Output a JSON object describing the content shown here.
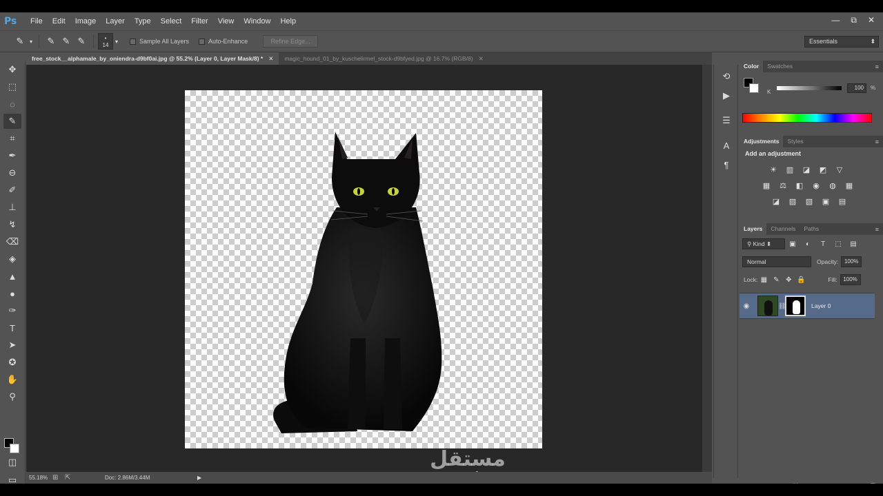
{
  "app": {
    "logo": "Ps"
  },
  "menu": [
    "File",
    "Edit",
    "Image",
    "Layer",
    "Type",
    "Select",
    "Filter",
    "View",
    "Window",
    "Help"
  ],
  "window_controls": {
    "minimize": "—",
    "restore": "⧉",
    "close": "✕"
  },
  "options": {
    "brush_size": "14",
    "sample_all_layers": "Sample All Layers",
    "auto_enhance": "Auto-Enhance",
    "refine_edge": "Refine Edge...",
    "workspace": "Essentials"
  },
  "tabs": [
    {
      "label": "free_stock__alphamale_by_oniendra-d9bf0ai.jpg @ 55.2% (Layer 0, Layer Mask/8) *",
      "close": "✕"
    },
    {
      "label": "magic_hound_01_by_kuschelirmel_stock-d9bfyed.jpg @ 16.7% (RGB/8)",
      "close": "✕"
    }
  ],
  "status": {
    "zoom": "55.18%",
    "doc": "Doc: 2.86M/3.44M"
  },
  "watermark": {
    "arabic": "مستقل",
    "latin": "mostaql.com"
  },
  "color_panel": {
    "tabs": [
      "Color",
      "Swatches"
    ],
    "k_label": "K",
    "k_value": "100",
    "unit": "%"
  },
  "adjust_panel": {
    "tabs": [
      "Adjustments",
      "Styles"
    ],
    "title": "Add an adjustment"
  },
  "layers_panel": {
    "tabs": [
      "Layers",
      "Channels",
      "Paths"
    ],
    "kind": "Kind",
    "blend_mode": "Normal",
    "opacity_label": "Opacity:",
    "opacity": "100%",
    "lock_label": "Lock:",
    "fill_label": "Fill:",
    "fill": "100%",
    "layer_name": "Layer 0"
  }
}
